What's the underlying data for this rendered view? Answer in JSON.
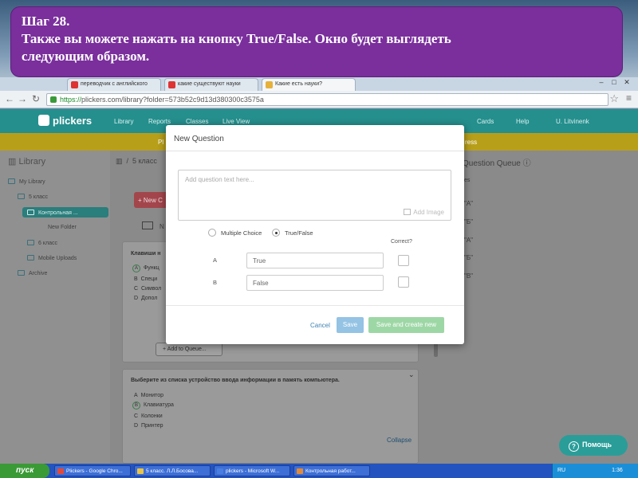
{
  "banner": {
    "line1": "Шаг 28.",
    "line2": "Также вы можете нажать на кнопку True/False. Окно будет выглядеть",
    "line3": "следующим образом."
  },
  "browser": {
    "tabs": [
      {
        "label": "переводчик с английского"
      },
      {
        "label": "какие существуют науки"
      },
      {
        "label": "Какие есть науки?"
      }
    ],
    "url_scheme": "https://",
    "url_rest": "plickers.com/library?folder=573b52c9d13d380300c3575a"
  },
  "app": {
    "logo": "plickers",
    "nav": [
      "Library",
      "Reports",
      "Classes",
      "Live View"
    ],
    "nav_right": [
      "Cards",
      "Help",
      "U. Litvinenk"
    ],
    "strip_left": "Pl",
    "strip_right": "ress"
  },
  "sidebar": {
    "title": "Library",
    "items": [
      "My Library",
      "5 класс",
      "Контрольная ...",
      "New Folder",
      "6 класс",
      "Mobile Uploads",
      "Archive"
    ]
  },
  "main": {
    "breadcrumb": "5 класс",
    "new_button": "+ New C",
    "newfolder_initial": "N",
    "card1": {
      "question": "Клавиши н",
      "options": [
        {
          "letter": "A",
          "text": "Функц"
        },
        {
          "letter": "B",
          "text": "Специ"
        },
        {
          "letter": "C",
          "text": "Символ"
        },
        {
          "letter": "D",
          "text": "Допол"
        }
      ],
      "add_to_queue": "+ Add to Queue..."
    },
    "card2": {
      "question": "Выберите из списка устройство ввода информации в память компьютера.",
      "options": [
        {
          "letter": "A",
          "text": "Монитор"
        },
        {
          "letter": "B",
          "text": "Клавиатура"
        },
        {
          "letter": "C",
          "text": "Колонки"
        },
        {
          "letter": "D",
          "text": "Принтер"
        }
      ],
      "collapse": "Collapse"
    }
  },
  "queue": {
    "title": "Question Queue",
    "items": [
      "\"A\"",
      "\"Б\"",
      "\"A\"",
      "\"Б\"",
      "\"В\""
    ],
    "label": "es"
  },
  "modal": {
    "title": "New Question",
    "question_placeholder": "Add question text here...",
    "add_image": "Add Image",
    "type_multiple": "Multiple Choice",
    "type_truefalse": "True/False",
    "correct_label": "Correct?",
    "answers": [
      {
        "letter": "A",
        "value": "True"
      },
      {
        "letter": "B",
        "value": "False"
      }
    ],
    "cancel": "Cancel",
    "save": "Save",
    "save_and_create": "Save and create new"
  },
  "help_button": "Помощь",
  "taskbar": {
    "start": "пуск",
    "tasks": [
      "Plickers - Google Chro...",
      "5 класс. Л.Л.Босова...",
      "plickers - Microsoft W...",
      "Контрольная работ..."
    ],
    "lang": "RU",
    "time": "1:36"
  }
}
